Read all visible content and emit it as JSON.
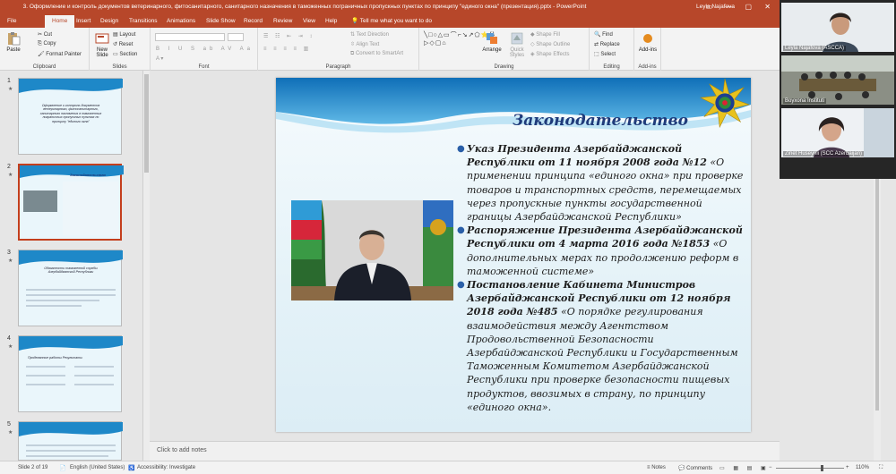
{
  "window": {
    "title": "3. Оформление и контроль документов ветеринарного, фитосанитарного, санитарного назначения в таможенных пограничных пропускных пунктах по принципу \"единого окна\" (презентация).pptx  -  PowerPoint",
    "user": "Leyla Najafova"
  },
  "tabs": [
    "File",
    "Home",
    "Insert",
    "Design",
    "Transitions",
    "Animations",
    "Slide Show",
    "Record",
    "Review",
    "View",
    "Help"
  ],
  "tell_me": "Tell me what you want to do",
  "ribbon": {
    "clipboard": {
      "label": "Clipboard",
      "paste": "Paste",
      "cut": "Cut",
      "copy": "Copy",
      "format_painter": "Format Painter"
    },
    "slides": {
      "label": "Slides",
      "new_slide": "New Slide",
      "layout": "Layout",
      "reset": "Reset",
      "section": "Section"
    },
    "font": {
      "label": "Font"
    },
    "paragraph": {
      "label": "Paragraph",
      "text_direction": "Text Direction",
      "align_text": "Align Text",
      "smartart": "Convert to SmartArt"
    },
    "drawing": {
      "label": "Drawing",
      "arrange": "Arrange",
      "quick_styles": "Quick Styles",
      "shape_fill": "Shape Fill",
      "shape_outline": "Shape Outline",
      "shape_effects": "Shape Effects"
    },
    "editing": {
      "label": "Editing",
      "find": "Find",
      "replace": "Replace",
      "select": "Select"
    },
    "addins": {
      "label": "Add-ins",
      "button": "Add-ins"
    }
  },
  "thumbnails": [
    {
      "num": "1",
      "text": "Оформление и контроль документов ветеринарного, фитосанитарного, санитарного назначения в таможенных пограничных пропускных пунктах по принципу \"единого окна\""
    },
    {
      "num": "2",
      "text": "Законодательство"
    },
    {
      "num": "3",
      "text": "Обязанности таможенной службы Азербайджанской Республики"
    },
    {
      "num": "4",
      "text": "Проделанные работы  Результаты"
    },
    {
      "num": "5",
      "text": ""
    }
  ],
  "slide": {
    "title": "Законодательство",
    "bullets": [
      {
        "bold": "Указ Президента Азербайджанской Республики от 11 ноября 2008 года №12",
        "rest": " «О применении принципа «единого окна» при проверке товаров и транспортных средств, перемещаемых через пропускные пункты государственной границы Азербайджанской Республики»"
      },
      {
        "bold": "Распоряжение Президента Азербайджанской Республики от 4 марта 2016 года №1853",
        "rest": " «О дополнительных мерах по продолжению реформ в таможенной системе»"
      },
      {
        "bold": "Постановление Кабинета Министров Азербайджанской Республики от 12 ноября 2018 года №485",
        "rest": " «О порядке регулирования взаимодействия между Агентством Продовольственной Безопасности Азербайджанской Республики и Государственным Таможенным Комитетом Азербайджанской Республики при проверке безопасности пищевых продуктов, ввозимых в страну, по принципу «единого окна»."
      }
    ]
  },
  "notes_placeholder": "Click to add notes",
  "status": {
    "slide_of": "Slide 2 of 19",
    "language": "English (United States)",
    "accessibility": "Accessibility: Investigate",
    "notes": "Notes",
    "comments": "Comments",
    "zoom": "110%"
  },
  "participants": [
    {
      "name": "Leyla Najafova (ASCCA)"
    },
    {
      "name": "Boyxona Instituti"
    },
    {
      "name": "Zinet Huseynli (SCC Azerbaijan)"
    }
  ],
  "colors": {
    "accent": "#b7472a",
    "slide_title": "#1f3a7a",
    "bullet": "#2a5fa8"
  }
}
